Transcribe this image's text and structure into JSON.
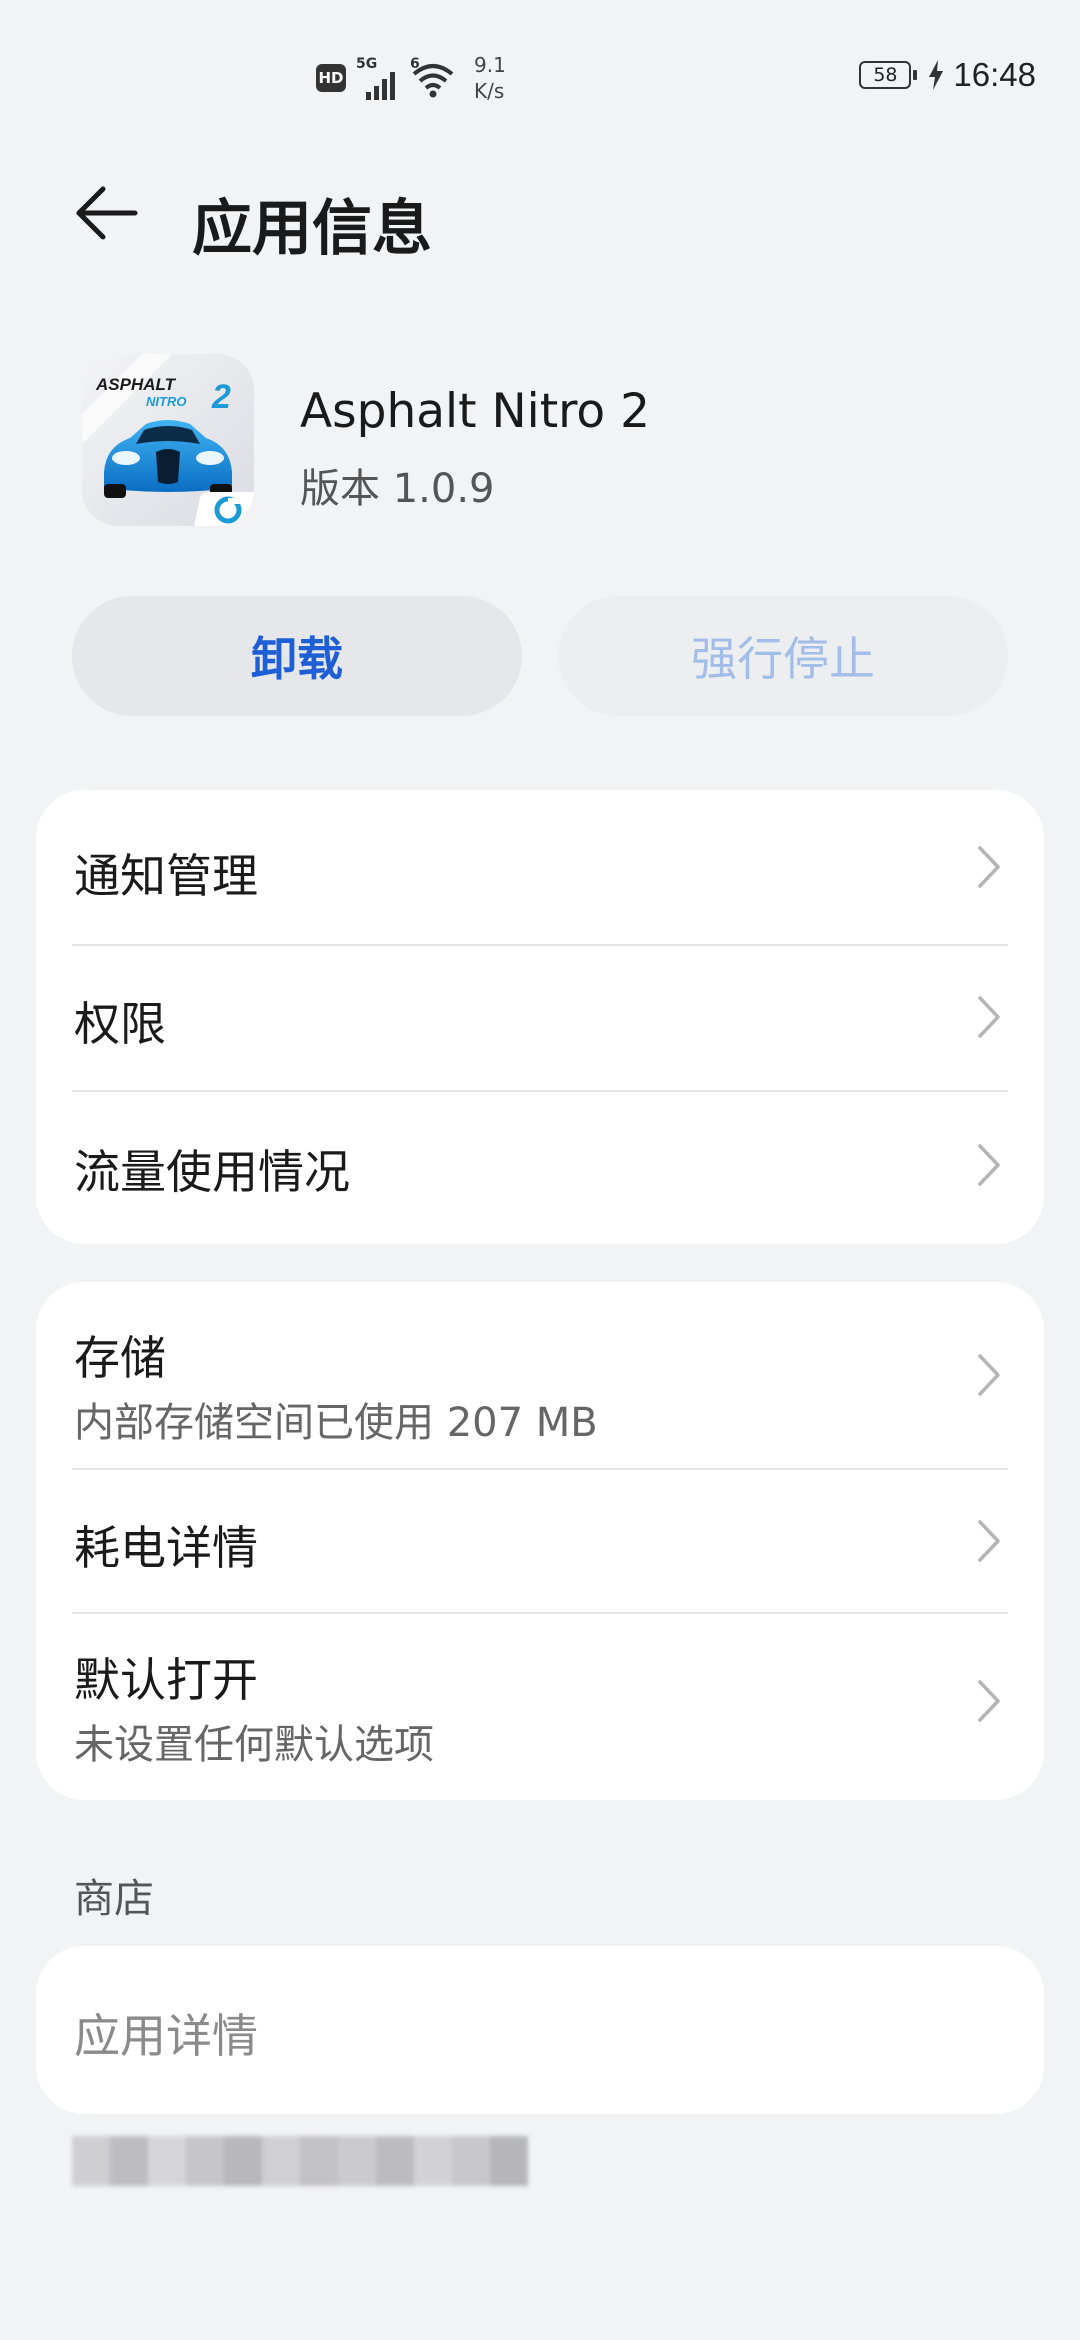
{
  "status_bar": {
    "hd": "HD",
    "signal_label": "5G",
    "wifi_label": "6",
    "speed_value": "9.1",
    "speed_unit": "K/s",
    "battery": "58",
    "time": "16:48"
  },
  "header": {
    "title": "应用信息"
  },
  "app": {
    "name": "Asphalt Nitro 2",
    "version": "版本 1.0.9",
    "icon_title_line1": "ASPHALT",
    "icon_title_line2": "NITRO",
    "icon_number": "2"
  },
  "actions": {
    "uninstall": "卸载",
    "force_stop": "强行停止"
  },
  "card1": {
    "items": [
      {
        "title": "通知管理"
      },
      {
        "title": "权限"
      },
      {
        "title": "流量使用情况"
      }
    ]
  },
  "card2": {
    "items": [
      {
        "title": "存储",
        "subtitle": "内部存储空间已使用 207 MB"
      },
      {
        "title": "耗电详情"
      },
      {
        "title": "默认打开",
        "subtitle": "未设置任何默认选项"
      }
    ]
  },
  "store": {
    "section_label": "商店",
    "app_details": "应用详情"
  },
  "colors": {
    "accent": "#1f5fd6",
    "disabled_text": "#a3bde9",
    "background": "#f1f3f5"
  }
}
